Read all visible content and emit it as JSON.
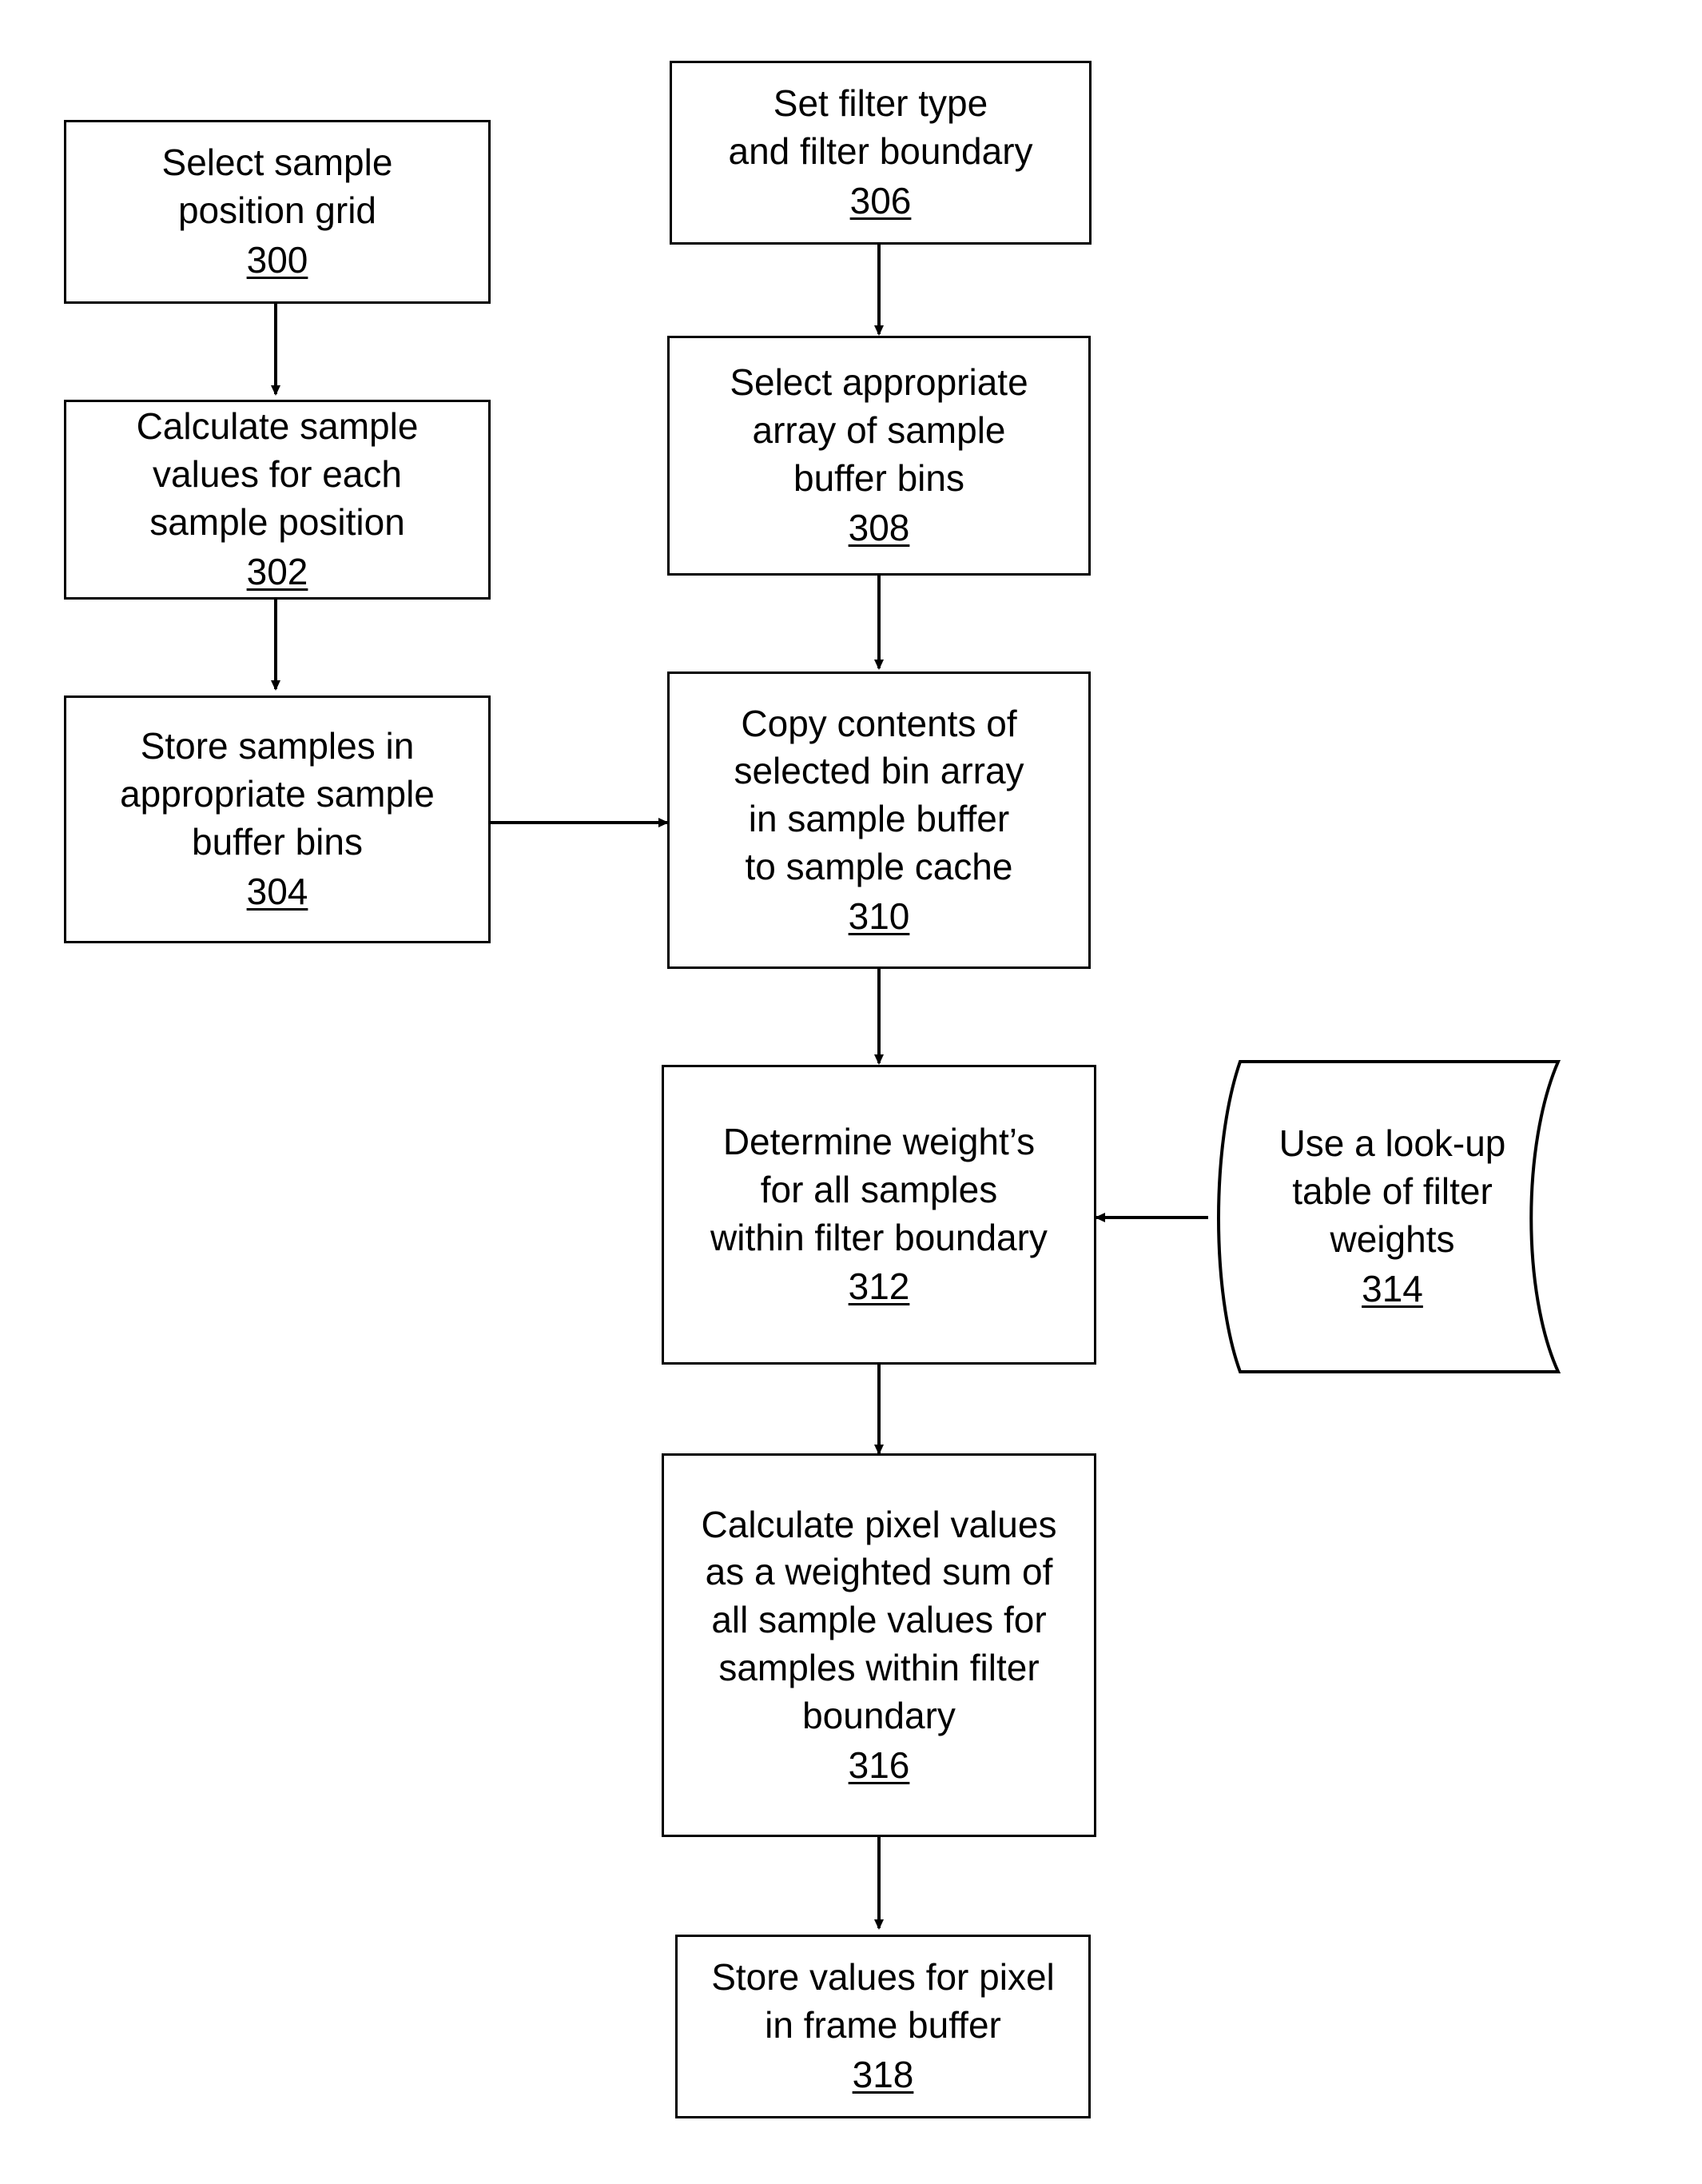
{
  "diagram": {
    "title": "Sample filtering and pixel value computation flowchart",
    "background_color": "#ffffff",
    "line_color": "#000000",
    "text_color": "#000000"
  },
  "nodes": {
    "n300": {
      "text": "Select sample\nposition grid",
      "ref": "300",
      "shape": "rectangle"
    },
    "n302": {
      "text": "Calculate sample\nvalues for each\nsample position",
      "ref": "302",
      "shape": "rectangle"
    },
    "n304": {
      "text": "Store samples in\nappropriate sample\nbuffer bins",
      "ref": "304",
      "shape": "rectangle"
    },
    "n306": {
      "text": "Set filter type\nand filter boundary",
      "ref": "306",
      "shape": "rectangle"
    },
    "n308": {
      "text": "Select appropriate\narray of sample\nbuffer bins",
      "ref": "308",
      "shape": "rectangle"
    },
    "n310": {
      "text": "Copy contents of\nselected bin array\nin sample buffer\nto sample cache",
      "ref": "310",
      "shape": "rectangle"
    },
    "n312": {
      "text": "Determine weight’s\nfor all samples\nwithin filter boundary",
      "ref": "312",
      "shape": "rectangle"
    },
    "n314": {
      "text": "Use a look-up\ntable of filter\nweights",
      "ref": "314",
      "shape": "tape"
    },
    "n316": {
      "text": "Calculate pixel values\nas a weighted sum of\nall sample values for\nsamples within filter\nboundary",
      "ref": "316",
      "shape": "rectangle"
    },
    "n318": {
      "text": "Store values for pixel\nin frame buffer",
      "ref": "318",
      "shape": "rectangle"
    }
  },
  "edges": [
    {
      "from": "n300",
      "to": "n302",
      "direction": "down"
    },
    {
      "from": "n302",
      "to": "n304",
      "direction": "down"
    },
    {
      "from": "n304",
      "to": "n310",
      "direction": "right"
    },
    {
      "from": "n306",
      "to": "n308",
      "direction": "down"
    },
    {
      "from": "n308",
      "to": "n310",
      "direction": "down"
    },
    {
      "from": "n310",
      "to": "n312",
      "direction": "down"
    },
    {
      "from": "n314",
      "to": "n312",
      "direction": "left"
    },
    {
      "from": "n312",
      "to": "n316",
      "direction": "down"
    },
    {
      "from": "n316",
      "to": "n318",
      "direction": "down"
    }
  ]
}
